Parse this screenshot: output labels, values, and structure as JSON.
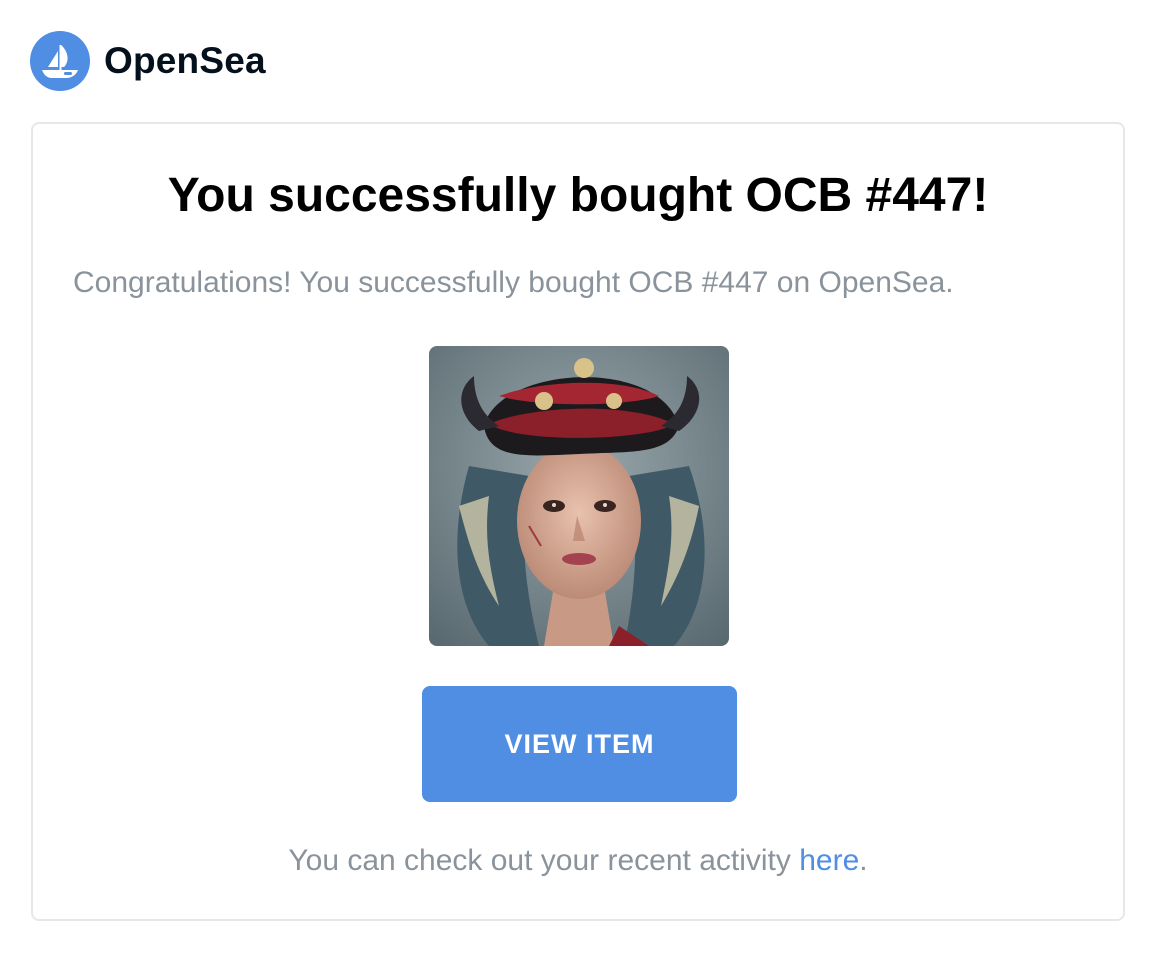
{
  "brand": {
    "name": "OpenSea",
    "logo_icon": "opensea-ship-icon",
    "accent_color": "#4f8ee3"
  },
  "card": {
    "title": "You successfully bought OCB #447!",
    "message": "Congratulations! You successfully bought OCB #447 on OpenSea.",
    "image_icon": "nft-portrait-image",
    "button_label": "VIEW ITEM",
    "footer_prefix": "You can check out your recent activity ",
    "footer_link": "here",
    "footer_suffix": "."
  }
}
